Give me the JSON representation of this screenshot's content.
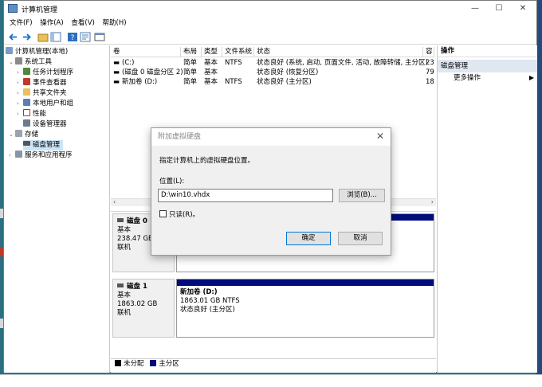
{
  "window": {
    "title": "计算机管理",
    "minimize": "—",
    "maximize": "☐",
    "close": "✕"
  },
  "menu": [
    "文件(F)",
    "操作(A)",
    "查看(V)",
    "帮助(H)"
  ],
  "tree": {
    "root": "计算机管理(本地)",
    "system_tools": "系统工具",
    "task_scheduler": "任务计划程序",
    "event_viewer": "事件查看器",
    "shared_folders": "共享文件夹",
    "local_users": "本地用户和组",
    "performance": "性能",
    "device_manager": "设备管理器",
    "storage": "存储",
    "disk_management": "磁盘管理",
    "services": "服务和应用程序"
  },
  "volumes": {
    "headers": [
      "卷",
      "布局",
      "类型",
      "文件系统",
      "状态",
      "容"
    ],
    "rows": [
      {
        "name": "(C:)",
        "layout": "简单",
        "type": "基本",
        "fs": "NTFS",
        "status": "状态良好 (系统, 启动, 页面文件, 活动, 故障转储, 主分区)",
        "cap": "23"
      },
      {
        "name": "(磁盘 0 磁盘分区 2)",
        "layout": "简单",
        "type": "基本",
        "fs": "",
        "status": "状态良好 (恢复分区)",
        "cap": "79"
      },
      {
        "name": "新加卷 (D:)",
        "layout": "简单",
        "type": "基本",
        "fs": "NTFS",
        "status": "状态良好 (主分区)",
        "cap": "18"
      }
    ]
  },
  "disks": [
    {
      "name": "磁盘 0",
      "kind": "基本",
      "size": "238.47 GB",
      "state": "联机"
    },
    {
      "name": "磁盘 1",
      "kind": "基本",
      "size": "1863.02 GB",
      "state": "联机",
      "part_name": "新加卷  (D:)",
      "part_size": "1863.01 GB NTFS",
      "part_status": "状态良好 (主分区)"
    }
  ],
  "legend": {
    "unallocated": "未分配",
    "primary": "主分区"
  },
  "actions": {
    "header": "操作",
    "section": "磁盘管理",
    "more": "更多操作"
  },
  "dialog": {
    "title": "附加虚拟硬盘",
    "description": "指定计算机上的虚拟硬盘位置。",
    "location_label": "位置(L):",
    "path_value": "D:\\win10.vhdx",
    "browse": "浏览(B)...",
    "readonly": "只读(R)。",
    "ok": "确定",
    "cancel": "取消",
    "close": "✕"
  },
  "colors": {
    "accent_bar": "#000c7c",
    "selection": "#cce4f7",
    "desktop": "#1e7f8c"
  }
}
